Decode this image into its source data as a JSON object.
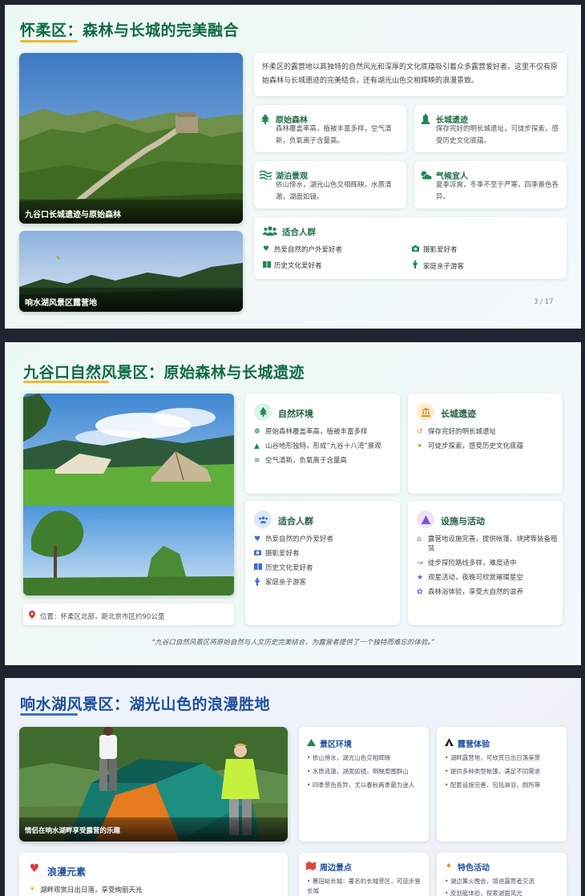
{
  "slide1": {
    "title": "怀柔区：森林与长城的完美融合",
    "intro": "怀柔区的露营地以其独特的自然风光和深厚的文化底蕴吸引着众多露营爱好者。这里不仅有原始森林与长城遗迹的完美结合，还有湖光山色交相辉映的浪漫景致。",
    "photo1_caption": "九谷口长城遗迹与原始森林",
    "photo2_caption": "响水湖风景区露营地",
    "features": [
      {
        "icon": "tree-icon",
        "title": "原始森林",
        "text": "森林覆盖率高，植被丰富多样，空气清新，负氧离子含量高。"
      },
      {
        "icon": "landmark-icon",
        "title": "长城遗迹",
        "text": "保存完好的明长城遗址，可徒步探索，感受历史文化底蕴。"
      },
      {
        "icon": "water-icon",
        "title": "湖泊景观",
        "text": "依山傍水，湖光山色交相辉映，水质清澈，湖面如镜。"
      },
      {
        "icon": "weather-icon",
        "title": "气候宜人",
        "text": "夏季凉爽，冬季不至于严寒，四季景色各异。"
      }
    ],
    "audience_title": "适合人群",
    "audience": [
      {
        "icon": "heart-icon",
        "text": "热爱自然的户外爱好者"
      },
      {
        "icon": "camera-icon",
        "text": "摄影爱好者"
      },
      {
        "icon": "book-icon",
        "text": "历史文化爱好者"
      },
      {
        "icon": "child-icon",
        "text": "家庭亲子游客"
      }
    ],
    "page": "3 / 17"
  },
  "slide2": {
    "title": "九谷口自然风景区：原始森林与长城遗迹",
    "location": "位置：怀柔区北部，距北京市区约90公里",
    "quote": "“九谷口自然风景区将原始自然与人文历史完美结合，为露营者提供了一个独特而难忘的体验。”",
    "nature": {
      "title": "自然环境",
      "items": [
        "原始森林覆盖率高，植被丰富多样",
        "山谷地形独特，形成“九谷十八湾”景观",
        "空气清新，负氧离子含量高"
      ]
    },
    "wall": {
      "title": "长城遗迹",
      "items": [
        "保存完好的明长城遗址",
        "可徒步探索，感受历史文化底蕴"
      ]
    },
    "people": {
      "title": "适合人群",
      "items": [
        "热爱自然的户外爱好者",
        "摄影爱好者",
        "历史文化爱好者",
        "家庭亲子游客"
      ]
    },
    "facilities": {
      "title": "设施与活动",
      "items": [
        "露营地设施完善，提供帐篷、烧烤等装备租赁",
        "徒步探险路线多样，难度适中",
        "观星活动，夜晚可欣赏璀璨星空",
        "森林浴体验，享受大自然的滋养"
      ]
    }
  },
  "slide3": {
    "title": "响水湖风景区：湖光山色的浪漫胜地",
    "photo_caption": "情侣在响水湖畔享受露营的乐趣",
    "scenery": {
      "title": "景区环境",
      "items": [
        "依山傍水，湖光山色交相辉映",
        "水质清澈，湖面如镜，倒映周围群山",
        "四季景色各异，尤以春秋两季最为迷人"
      ]
    },
    "camping": {
      "title": "露营体验",
      "items": [
        "湖畔露营地，可欣赏日出日落美景",
        "提供多种类型帐篷，满足不同需求",
        "配套设施完善，包括淋浴、厕所等"
      ]
    },
    "romance": {
      "title": "浪漫元素",
      "items": [
        "湖畔观赏日出日落，享受绚丽天光"
      ]
    },
    "nearby": {
      "title": "周边景点",
      "items": [
        "慕田峪长城：著名的长城景区，可徒步登长城"
      ]
    },
    "activities": {
      "title": "特色活动",
      "items": [
        "湖边篝火晚会，增进露营者交流",
        "皮划艇体验，探索湖面风光"
      ]
    }
  },
  "colors": {
    "green_title": "#0f6b45",
    "blue_title": "#1e4fa0",
    "gold_bar": "#f2b631",
    "green_accent": "#1a8a52"
  }
}
